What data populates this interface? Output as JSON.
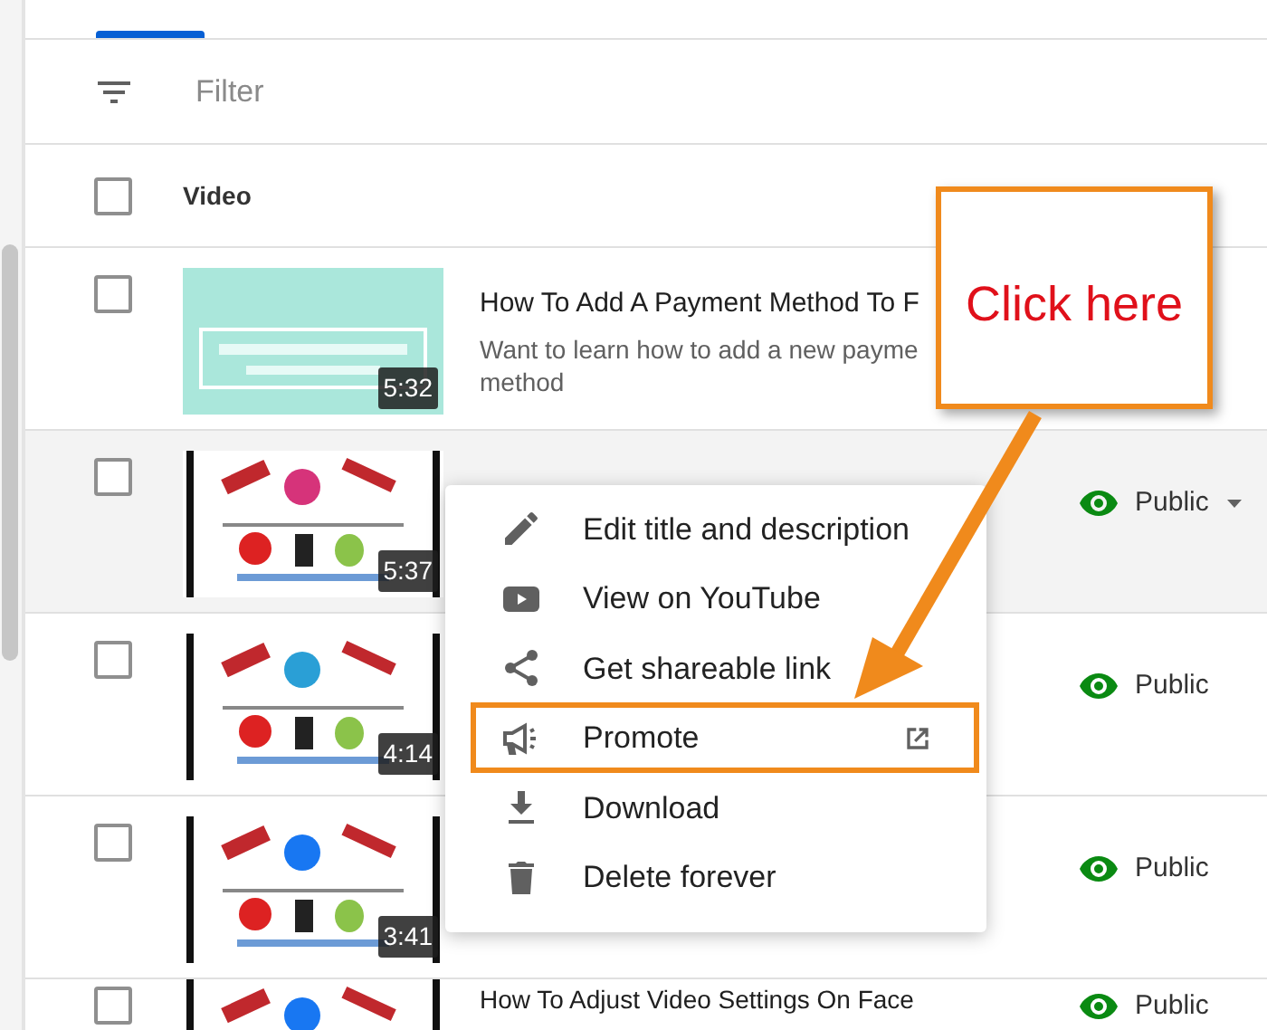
{
  "filter": {
    "placeholder": "Filter"
  },
  "table": {
    "header": "Video",
    "header_checked": false,
    "rows": [
      {
        "checked": false,
        "hovered": false,
        "title": "How To Add A Payment Method To F",
        "description": "Want to learn how to add a new payme\nmethod",
        "duration": "5:32"
      },
      {
        "checked": false,
        "hovered": true,
        "duration": "5:37",
        "visibility": "Public"
      },
      {
        "checked": false,
        "hovered": false,
        "duration": "4:14",
        "visibility": "Public"
      },
      {
        "checked": false,
        "hovered": false,
        "duration": "3:41",
        "visibility": "Public"
      },
      {
        "checked": false,
        "hovered": false,
        "title": "How To Adjust Video Settings On Face",
        "visibility": "Public"
      }
    ]
  },
  "menu": {
    "items": [
      {
        "kind": "edit",
        "label": "Edit title and description",
        "external": false,
        "highlighted": false
      },
      {
        "kind": "play",
        "label": "View on YouTube",
        "external": false,
        "highlighted": false
      },
      {
        "kind": "share",
        "label": "Get shareable link",
        "external": false,
        "highlighted": false
      },
      {
        "kind": "promote",
        "label": "Promote",
        "external": true,
        "highlighted": true
      },
      {
        "kind": "download",
        "label": "Download",
        "external": false,
        "highlighted": false
      },
      {
        "kind": "delete",
        "label": "Delete forever",
        "external": false,
        "highlighted": false
      }
    ]
  },
  "annotation": {
    "callout": "Click here"
  }
}
